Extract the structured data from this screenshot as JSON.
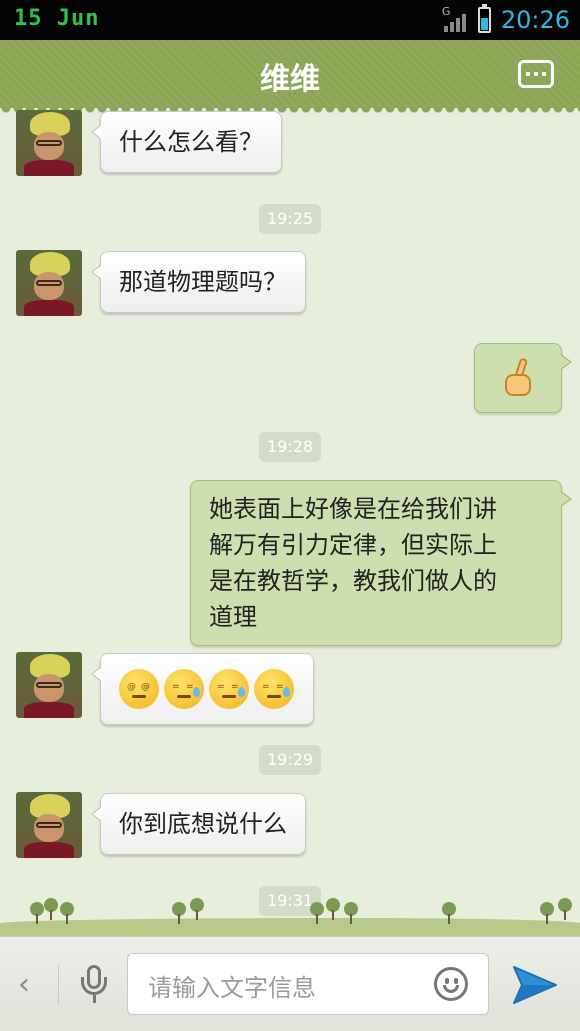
{
  "status_bar": {
    "date": "15 Jun",
    "network": "G",
    "time": "20:26"
  },
  "header": {
    "title": "维维"
  },
  "messages": [
    {
      "side": "in",
      "text": "什么怎么看？"
    },
    {
      "timestamp": "19:25"
    },
    {
      "side": "in",
      "text": "那道物理题吗？"
    },
    {
      "side": "out",
      "icon": "pointing-hand-emoji"
    },
    {
      "timestamp": "19:28"
    },
    {
      "side": "out",
      "lines": [
        "她表面上好像是在给我们讲",
        "解万有引力定律，但实际上",
        "是在教哲学，教我们做人的",
        "道理"
      ]
    },
    {
      "side": "in",
      "icons": [
        "dizzy-face-emoji",
        "sweat-face-emoji",
        "sweat-face-emoji",
        "sweat-face-emoji"
      ]
    },
    {
      "timestamp": "19:29"
    },
    {
      "side": "in",
      "text": "你到底想说什么"
    },
    {
      "timestamp": "19:31"
    }
  ],
  "input_bar": {
    "placeholder": "请输入文字信息"
  },
  "colors": {
    "header_green": "#8ca556",
    "chat_background": "#e7efdc",
    "outgoing_bubble": "#cddfae",
    "time_blue": "#33b5e5",
    "date_green": "#2fc34b"
  }
}
